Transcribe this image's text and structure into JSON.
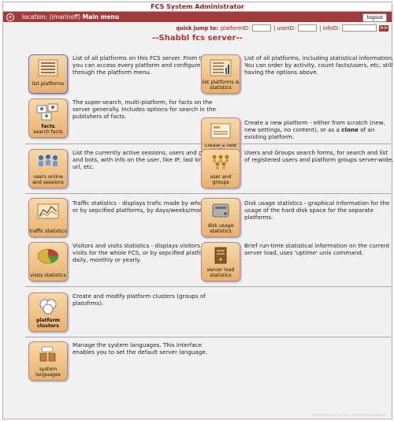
{
  "header": {
    "title": "FCS System Administrator",
    "location_prefix": "location: (imarinoff)",
    "location_page": "Main menu",
    "logout_label": "logout"
  },
  "quick_jump": {
    "label": "quick jump to:",
    "platform_id_label": "platformID:",
    "user_id_label": "| userID:",
    "info_id_label": "| infoID:",
    "go_label": ">>"
  },
  "page_heading": "--Shabbl fcs server--",
  "menu": {
    "list_platforms": {
      "label": "list platforms",
      "desc": "List of all platforms on this FCS server. From this list you can access every platform and configure it, through the platform menu."
    },
    "list_platforms_stats": {
      "label": "list platforms & statistics",
      "desc": "List of all platforms, including statistical information. You can order by activity, count facts/users, etc, still having the options above."
    },
    "search_facts": {
      "label": "facts search facts",
      "label_top": "facts",
      "label_bottom": "search facts",
      "desc": "The super-search, multi-platform, for facts on the server generally. Includes options for search in the publishers of facts."
    },
    "create_platform": {
      "label": "create a new platform",
      "desc_pre": "Create a new platform - either from scratch (new, new settings, no content), or as a ",
      "desc_bold": "clone",
      "desc_post": " of an existing platform."
    },
    "users_online": {
      "label": "users online and sessions",
      "desc": "List the currently active sessions, users and guest, and bots, with info on the user, like IP, last known url, etc."
    },
    "user_groups": {
      "label": "user and groups",
      "desc": "Users and Groups search forms, for search and list of registered users and platform groups server-wide."
    },
    "traffic_stats": {
      "label": "traffic statistics",
      "desc": "Traffic statistics - displays trafic made by whole FCS, or by sepcified platforms, by days/weeks/months."
    },
    "disk_usage": {
      "label": "disk usage statistics",
      "desc": "Disk usage statistics - graphical information for the usage of the hard disk space for the separate platforms."
    },
    "visits_stats": {
      "label": "visits statistics",
      "desc": "Visitors and visits statistics - displays visitors and visits for the whole FCS, or by sepcified platforms, daily, monthly or yearly."
    },
    "server_load": {
      "label": "server load statistics",
      "desc": "Brief run-time statistical information on the current server load, uses 'uptime' unix command."
    },
    "platform_clusters": {
      "label": "platform clusters",
      "desc": "Create and modify platform clusters (groups of platofrms)."
    },
    "system_languages": {
      "label": "system languages",
      "desc": "Manage the system languages. This interface enables you to set the default server language."
    }
  },
  "footer_text": "powered by fcs.bg: community server",
  "colors": {
    "accent": "#a23b3b",
    "background": "#f1f1f1",
    "icon_bg": "#f0c48a"
  },
  "icons": [
    "list-icon",
    "table-chart-icon",
    "facts-cards-icon",
    "new-platform-icon",
    "users-online-icon",
    "user-groups-icon",
    "traffic-chart-icon",
    "disk-icon",
    "pie-chart-icon",
    "server-icon",
    "clusters-icon",
    "languages-icon"
  ]
}
